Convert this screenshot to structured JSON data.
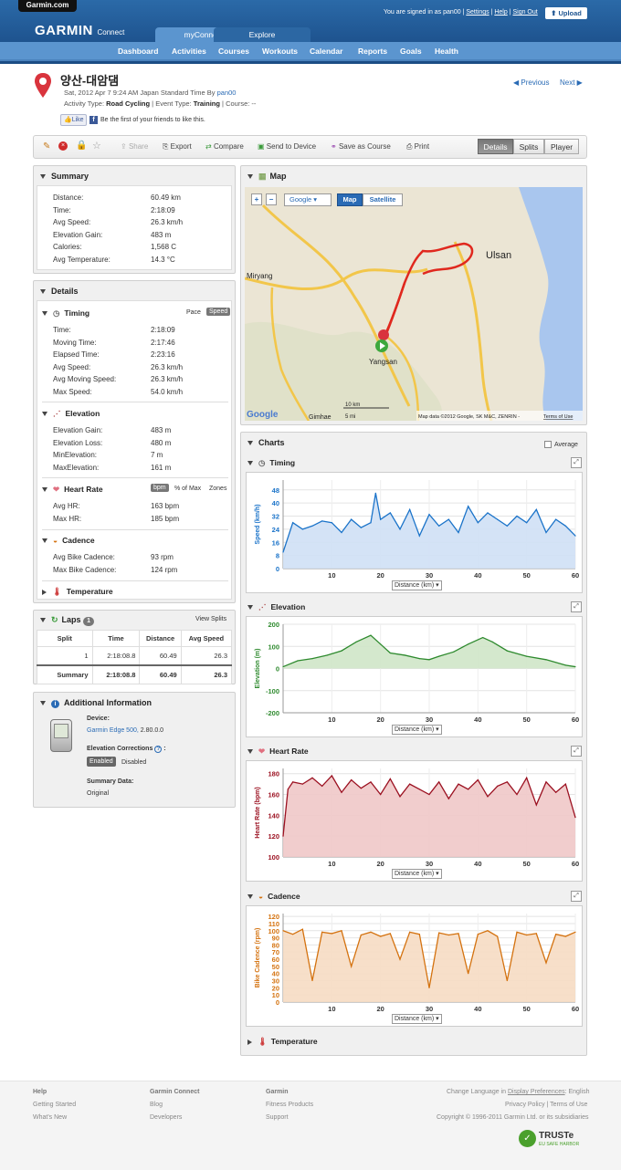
{
  "header": {
    "garmin_tab": "Garmin.com",
    "logo": "GARMIN",
    "logo_sub": "Connect",
    "signed_in": "You are signed in as",
    "username": "pan00",
    "settings": "Settings",
    "help": "Help",
    "sign_out": "Sign Out",
    "upload": "Upload",
    "tabs": [
      "myConnect",
      "Explore"
    ],
    "nav": [
      "Dashboard",
      "Activities",
      "Courses",
      "Workouts",
      "Calendar",
      "Reports",
      "Goals",
      "Health"
    ]
  },
  "activity": {
    "title": "양산-대암댐",
    "date_line": "Sat, 2012 Apr 7 9:24 AM Japan Standard Time By",
    "by_user": "pan00",
    "type_label": "Activity Type:",
    "type": "Road Cycling",
    "event_label": "| Event Type:",
    "event": "Training",
    "course_label": "| Course: --",
    "like": "Like",
    "like_text": "Be the first of your friends to like this.",
    "previous": "Previous",
    "next": "Next"
  },
  "toolbar": {
    "share": "Share",
    "export": "Export",
    "compare": "Compare",
    "send": "Send to Device",
    "save_course": "Save as Course",
    "print": "Print",
    "details": "Details",
    "splits": "Splits",
    "player": "Player"
  },
  "summary": {
    "title": "Summary",
    "rows": [
      [
        "Distance:",
        "60.49 km"
      ],
      [
        "Time:",
        "2:18:09"
      ],
      [
        "Avg Speed:",
        "26.3 km/h"
      ],
      [
        "Elevation Gain:",
        "483 m"
      ],
      [
        "Calories:",
        "1,568 C"
      ],
      [
        "Avg Temperature:",
        "14.3 °C"
      ]
    ]
  },
  "details": {
    "title": "Details",
    "timing": {
      "title": "Timing",
      "pace": "Pace",
      "speed": "Speed",
      "rows": [
        [
          "Time:",
          "2:18:09"
        ],
        [
          "Moving Time:",
          "2:17:46"
        ],
        [
          "Elapsed Time:",
          "2:23:16"
        ],
        [
          "Avg Speed:",
          "26.3 km/h"
        ],
        [
          "Avg Moving Speed:",
          "26.3 km/h"
        ],
        [
          "Max Speed:",
          "54.0 km/h"
        ]
      ]
    },
    "elevation": {
      "title": "Elevation",
      "rows": [
        [
          "Elevation Gain:",
          "483 m"
        ],
        [
          "Elevation Loss:",
          "480 m"
        ],
        [
          "MinElevation:",
          "7 m"
        ],
        [
          "MaxElevation:",
          "161 m"
        ]
      ]
    },
    "heart": {
      "title": "Heart Rate",
      "bpm": "bpm",
      "pmax": "% of Max",
      "zones": "Zones",
      "rows": [
        [
          "Avg HR:",
          "163 bpm"
        ],
        [
          "Max HR:",
          "185 bpm"
        ]
      ]
    },
    "cadence": {
      "title": "Cadence",
      "rows": [
        [
          "Avg Bike Cadence:",
          "93 rpm"
        ],
        [
          "Max Bike Cadence:",
          "124 rpm"
        ]
      ]
    },
    "temperature": {
      "title": "Temperature"
    }
  },
  "laps": {
    "title": "Laps",
    "count": "1",
    "view_splits": "View Splits",
    "headers": [
      "Split",
      "Time",
      "Distance",
      "Avg Speed"
    ],
    "rows": [
      [
        "1",
        "2:18:08.8",
        "60.49",
        "26.3"
      ],
      [
        "Summary",
        "2:18:08.8",
        "60.49",
        "26.3"
      ]
    ]
  },
  "additional": {
    "title": "Additional Information",
    "device_label": "Device:",
    "device": "Garmin Edge 500,",
    "device_ver": "2.80.0.0",
    "elev_corr": "Elevation Corrections",
    "enabled": "Enabled",
    "disabled": "Disabled",
    "summary_label": "Summary Data:",
    "summary_val": "Original"
  },
  "map": {
    "title": "Map",
    "google": "Google",
    "map_btn": "Map",
    "satellite": "Satellite",
    "places": [
      "Ulsan",
      "Miryang",
      "Yangsan",
      "Gimhae"
    ],
    "scale_km": "10 km",
    "scale_mi": "5 mi",
    "credit": "Map data ©2012 Google, SK M&C, ZENRIN -",
    "terms": "Terms of Use",
    "google_logo": "Google"
  },
  "charts": {
    "title": "Charts",
    "average": "Average",
    "xlabel": "Distance (km)"
  },
  "chart_data": [
    {
      "type": "line",
      "title": "Timing",
      "ylabel": "Speed (km/h)",
      "color": "#1a73c9",
      "fill": "#cfe0f5",
      "xlim": [
        0,
        60
      ],
      "ylim": [
        0,
        54
      ],
      "yticks": [
        0,
        8,
        16,
        24,
        32,
        40,
        48
      ],
      "xticks": [
        10,
        20,
        30,
        40,
        50,
        60
      ],
      "x": [
        0,
        2,
        4,
        6,
        8,
        10,
        12,
        14,
        16,
        18,
        19,
        20,
        22,
        24,
        26,
        28,
        30,
        32,
        34,
        36,
        38,
        40,
        42,
        44,
        46,
        48,
        50,
        52,
        54,
        56,
        58,
        60
      ],
      "y": [
        10,
        28,
        24,
        26,
        29,
        28,
        22,
        30,
        25,
        28,
        46,
        30,
        34,
        24,
        36,
        20,
        33,
        26,
        30,
        22,
        38,
        28,
        34,
        30,
        26,
        32,
        28,
        36,
        22,
        30,
        26,
        20
      ]
    },
    {
      "type": "line",
      "title": "Elevation",
      "ylabel": "Elevation (m)",
      "color": "#2e8a2e",
      "fill": "#cfe6c8",
      "xlim": [
        0,
        60
      ],
      "ylim": [
        -200,
        200
      ],
      "yticks": [
        -200,
        -100,
        0,
        100,
        200
      ],
      "xticks": [
        10,
        20,
        30,
        40,
        50,
        60
      ],
      "x": [
        0,
        3,
        6,
        9,
        12,
        15,
        18,
        20,
        22,
        25,
        28,
        30,
        32,
        35,
        38,
        41,
        43,
        46,
        50,
        54,
        58,
        60
      ],
      "y": [
        8,
        35,
        45,
        60,
        80,
        120,
        150,
        110,
        70,
        60,
        45,
        40,
        55,
        75,
        110,
        140,
        120,
        80,
        55,
        40,
        15,
        8
      ]
    },
    {
      "type": "line",
      "title": "Heart Rate",
      "ylabel": "Heart Rate (bpm)",
      "color": "#9b1020",
      "fill": "#f0c8c8",
      "xlim": [
        0,
        60
      ],
      "ylim": [
        100,
        185
      ],
      "yticks": [
        100,
        120,
        140,
        160,
        180
      ],
      "xticks": [
        10,
        20,
        30,
        40,
        50,
        60
      ],
      "x": [
        0,
        1,
        2,
        4,
        6,
        8,
        10,
        12,
        14,
        16,
        18,
        20,
        22,
        24,
        26,
        28,
        30,
        32,
        34,
        36,
        38,
        40,
        42,
        44,
        46,
        48,
        50,
        52,
        54,
        56,
        58,
        60
      ],
      "y": [
        120,
        165,
        172,
        170,
        176,
        168,
        178,
        162,
        174,
        166,
        172,
        160,
        175,
        158,
        170,
        165,
        160,
        172,
        156,
        170,
        165,
        174,
        158,
        168,
        172,
        160,
        176,
        150,
        172,
        162,
        170,
        138
      ]
    },
    {
      "type": "line",
      "title": "Cadence",
      "ylabel": "Bike Cadence (rpm)",
      "color": "#d4720f",
      "fill": "#f6dcc3",
      "xlim": [
        0,
        60
      ],
      "ylim": [
        0,
        124
      ],
      "yticks": [
        0,
        10,
        20,
        30,
        40,
        50,
        60,
        70,
        80,
        90,
        100,
        110,
        120
      ],
      "xticks": [
        10,
        20,
        30,
        40,
        50,
        60
      ],
      "x": [
        0,
        2,
        4,
        6,
        8,
        10,
        12,
        14,
        16,
        18,
        20,
        22,
        24,
        26,
        28,
        30,
        32,
        34,
        36,
        38,
        40,
        42,
        44,
        46,
        48,
        50,
        52,
        54,
        56,
        58,
        60
      ],
      "y": [
        100,
        95,
        102,
        30,
        98,
        96,
        100,
        50,
        94,
        98,
        92,
        96,
        60,
        98,
        95,
        20,
        97,
        94,
        96,
        40,
        95,
        100,
        92,
        30,
        98,
        94,
        96,
        55,
        95,
        92,
        98
      ]
    }
  ],
  "temperature2": {
    "title": "Temperature"
  },
  "footer": {
    "col1": [
      "Help",
      "Getting Started",
      "What's New"
    ],
    "col2": [
      "Garmin Connect",
      "Blog",
      "Developers"
    ],
    "col3": [
      "Garmin",
      "Fitness Products",
      "Support"
    ],
    "lang": "Change Language in",
    "lang_link": "Display Preferences",
    "lang_val": ": English",
    "policy": "Privacy Policy | Terms of Use",
    "copyright": "Copyright © 1996-2011 Garmin Ltd. or its subsidiaries",
    "truste": "TRUSTe",
    "truste_sub": "EU SAFE HARBOR"
  }
}
